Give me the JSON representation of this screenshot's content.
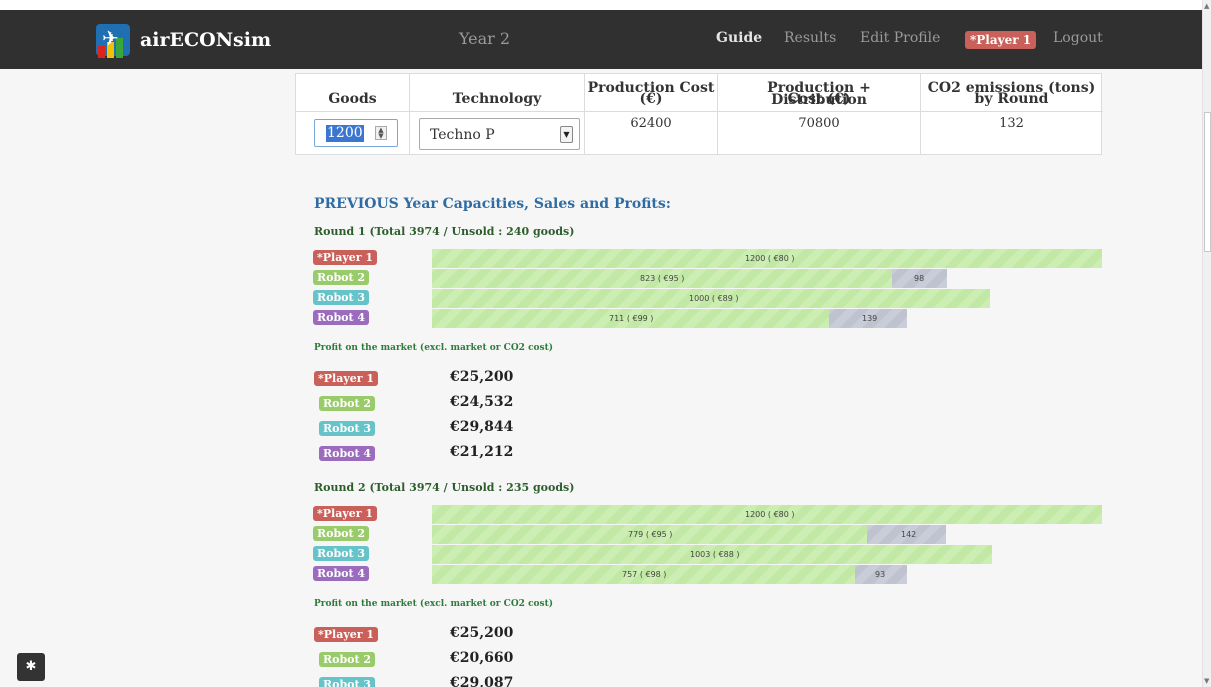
{
  "navbar": {
    "brand": "airECONsim",
    "year": "Year 2",
    "links": {
      "guide": "Guide",
      "results": "Results",
      "edit_profile": "Edit Profile",
      "logout": "Logout"
    },
    "player_badge": "*Player 1"
  },
  "production": {
    "headers": {
      "goods": "Goods",
      "technology": "Technology",
      "prod_cost_1": "Production Cost",
      "prod_cost_2": "(€)",
      "dist_cost_1": "Production + Distribution",
      "dist_cost_2": "Cost (€)",
      "co2_1": "CO2 emissions (tons)",
      "co2_2": "by Round"
    },
    "goods_value": "1200",
    "technology_value": "Techno P",
    "production_cost": "62400",
    "production_distribution_cost": "70800",
    "co2_emissions": "132"
  },
  "previous": {
    "title": "PREVIOUS Year Capacities, Sales and Profits:",
    "rounds": [
      {
        "title": "Round 1 (Total 3974 / Unsold : 240 goods)",
        "bars": [
          {
            "player": "*Player 1",
            "sold": 1200,
            "price": 80,
            "unsold": null,
            "label": "1200 ( €80 )",
            "unsold_label": ""
          },
          {
            "player": "Robot 2",
            "sold": 823,
            "price": 95,
            "unsold": 98,
            "label": "823 ( €95 )",
            "unsold_label": "98"
          },
          {
            "player": "Robot 3",
            "sold": 1000,
            "price": 89,
            "unsold": null,
            "label": "1000 ( €89 )",
            "unsold_label": ""
          },
          {
            "player": "Robot 4",
            "sold": 711,
            "price": 99,
            "unsold": 139,
            "label": "711 ( €99 )",
            "unsold_label": "139"
          }
        ],
        "profit_title": "Profit on the market (excl. market or CO2 cost)",
        "profits": [
          {
            "player": "*Player 1",
            "value": "€25,200"
          },
          {
            "player": "Robot 2",
            "value": "€24,532"
          },
          {
            "player": "Robot 3",
            "value": "€29,844"
          },
          {
            "player": "Robot 4",
            "value": "€21,212"
          }
        ]
      },
      {
        "title": "Round 2 (Total 3974 / Unsold : 235 goods)",
        "bars": [
          {
            "player": "*Player 1",
            "sold": 1200,
            "price": 80,
            "unsold": null,
            "label": "1200 ( €80 )",
            "unsold_label": ""
          },
          {
            "player": "Robot 2",
            "sold": 779,
            "price": 95,
            "unsold": 142,
            "label": "779 ( €95 )",
            "unsold_label": "142"
          },
          {
            "player": "Robot 3",
            "sold": 1003,
            "price": 88,
            "unsold": null,
            "label": "1003 ( €88 )",
            "unsold_label": ""
          },
          {
            "player": "Robot 4",
            "sold": 757,
            "price": 98,
            "unsold": 93,
            "label": "757 ( €98 )",
            "unsold_label": "93"
          }
        ],
        "profit_title": "Profit on the market (excl. market or CO2 cost)",
        "profits": [
          {
            "player": "*Player 1",
            "value": "€25,200"
          },
          {
            "player": "Robot 2",
            "value": "€20,660"
          },
          {
            "player": "Robot 3",
            "value": "€29,087"
          }
        ]
      }
    ]
  },
  "colors": {
    "player": "#c9605a",
    "robot2": "#9acb6a",
    "robot3": "#66c3c9",
    "robot4": "#9b6bbd",
    "sold_bar": "#cdeeb2",
    "unsold_bar": "#c9cdd8"
  }
}
